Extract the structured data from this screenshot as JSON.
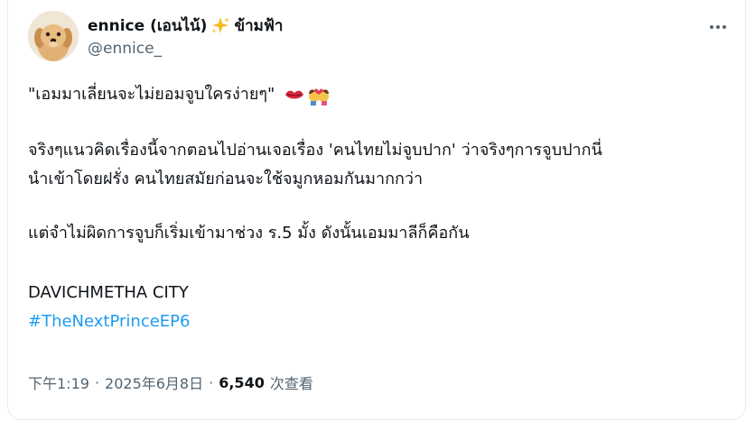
{
  "author": {
    "display_name": "ennice (เอนไน้)",
    "display_name_suffix": "ข้ามฟ้า",
    "handle": "@ennice_",
    "sparkle_icon": "sparkles-emoji"
  },
  "tweet": {
    "line1": "\"เอมมาเลี่ยนจะไม่ยอมจูบใครง่ายๆ\"",
    "line1_emojis": [
      "kiss-mark-emoji",
      "kiss-couple-emoji"
    ],
    "line2": "จริงๆแนวคิดเรื่องนี้จากตอนไปอ่านเจอเรื่อง 'คนไทยไม่จูบปาก' ว่าจริงๆการจูบปากนี่",
    "line3": "นำเข้าโดยฝรั่ง คนไทยสมัยก่อนจะใช้จมูกหอมกันมากกว่า",
    "line4": "แต่จำไม่ผิดการจูบก็เริ่มเข้ามาช่วง ร.5 มั้ง ดังนั้นเอมมาลีก็คือกัน",
    "line5": "DAVICHMETHA CITY",
    "hashtag": "#TheNextPrinceEP6"
  },
  "meta": {
    "time": "下午1:19",
    "date": "2025年6月8日",
    "views_count": "6,540",
    "views_label": "次查看"
  },
  "colors": {
    "link": "#1d9bf0",
    "secondary_text": "#536471",
    "primary_text": "#0f1419"
  }
}
